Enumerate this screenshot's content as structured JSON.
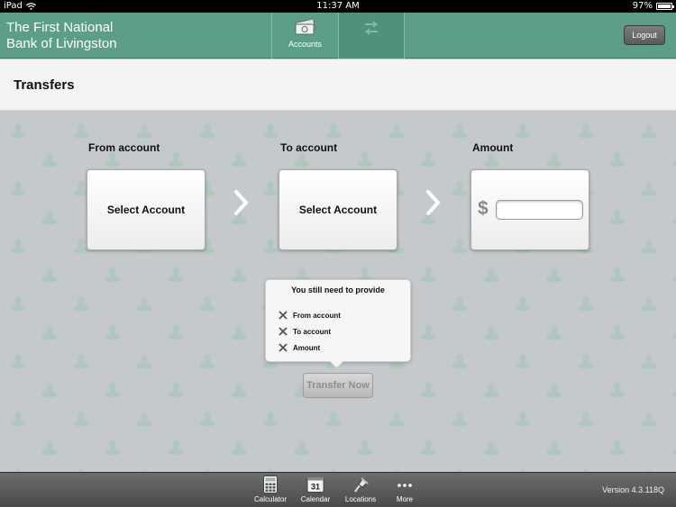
{
  "status_bar": {
    "device": "iPad",
    "time": "11:37 AM",
    "battery": "97%",
    "battery_level": 0.97
  },
  "header": {
    "bank_name_line1": "The First National",
    "bank_name_line2": "Bank of Livingston",
    "tabs": [
      {
        "label": "Accounts",
        "icon": "money-icon"
      },
      {
        "label": "Transfers",
        "icon": "transfer-icon"
      }
    ],
    "logout_label": "Logout"
  },
  "page": {
    "title": "Transfers"
  },
  "transfer_form": {
    "from_label": "From account",
    "from_button": "Select Account",
    "to_label": "To account",
    "to_button": "Select Account",
    "amount_label": "Amount",
    "currency_symbol": "$",
    "amount_value": "",
    "amount_placeholder": ""
  },
  "validation_popup": {
    "title": "You still need to provide",
    "items": [
      "From account",
      "To account",
      "Amount"
    ]
  },
  "transfer_button": "Transfer Now",
  "toolbar": {
    "items": [
      {
        "label": "Calculator",
        "icon": "calculator-icon"
      },
      {
        "label": "Calendar",
        "icon": "calendar-icon",
        "day": "31"
      },
      {
        "label": "Locations",
        "icon": "map-pin-icon"
      },
      {
        "label": "More",
        "icon": "more-icon"
      }
    ],
    "version": "Version 4.3.118Q"
  }
}
